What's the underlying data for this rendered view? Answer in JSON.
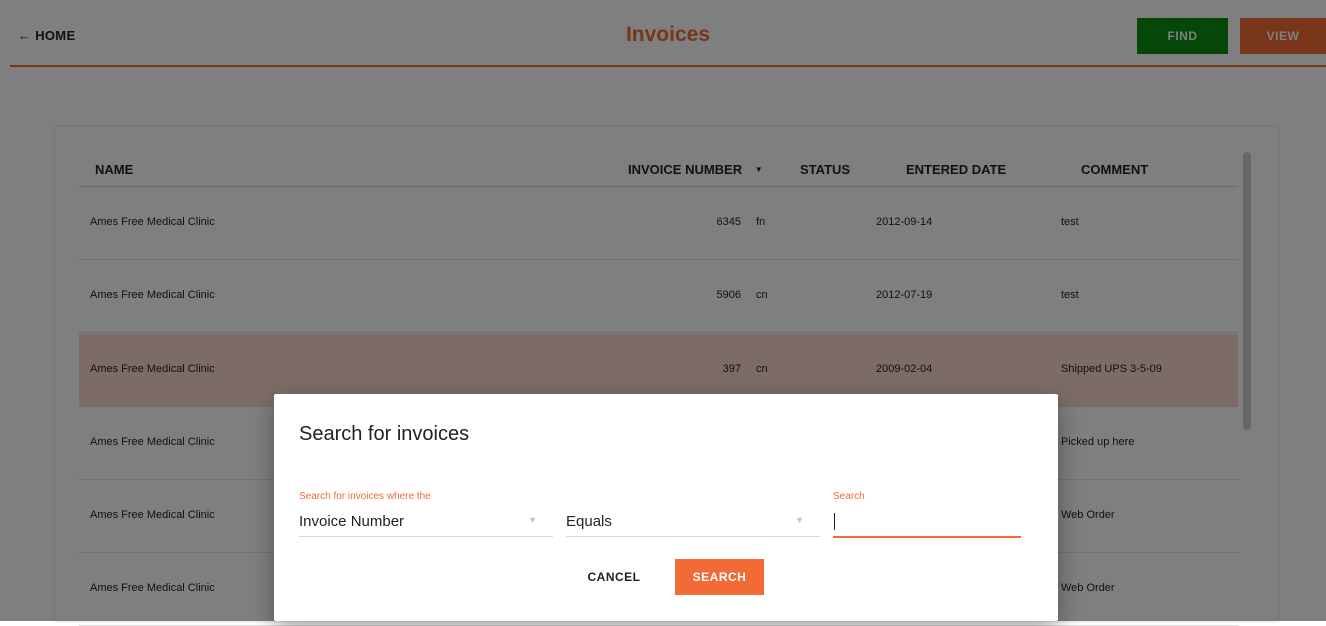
{
  "header": {
    "home_label": "← HOME",
    "title": "Invoices",
    "find_label": "FIND",
    "view_label": "VIEW"
  },
  "table": {
    "columns": [
      "NAME",
      "INVOICE NUMBER",
      "STATUS",
      "ENTERED DATE",
      "COMMENT"
    ],
    "sort_indicator": "▼",
    "rows": [
      {
        "name": "Ames Free Medical Clinic",
        "invoice_number": "6345",
        "status": "fn",
        "entered_date": "2012-09-14",
        "comment": "test"
      },
      {
        "name": "Ames Free Medical Clinic",
        "invoice_number": "5906",
        "status": "cn",
        "entered_date": "2012-07-19",
        "comment": "test"
      },
      {
        "name": "Ames Free Medical Clinic",
        "invoice_number": "397",
        "status": "cn",
        "entered_date": "2009-02-04",
        "comment": "Shipped UPS 3-5-09"
      },
      {
        "name": "Ames Free Medical Clinic",
        "invoice_number": "",
        "status": "",
        "entered_date": "",
        "comment": "Picked up here"
      },
      {
        "name": "Ames Free Medical Clinic",
        "invoice_number": "",
        "status": "",
        "entered_date": "",
        "comment": "Web Order"
      },
      {
        "name": "Ames Free Medical Clinic",
        "invoice_number": "",
        "status": "",
        "entered_date": "",
        "comment": "Web Order"
      }
    ]
  },
  "dialog": {
    "title": "Search for invoices",
    "field_label": "Search for invoices where the",
    "field_value": "Invoice Number",
    "operator_value": "Equals",
    "search_label": "Search",
    "search_value": "",
    "cancel_label": "CANCEL",
    "submit_label": "SEARCH"
  },
  "colors": {
    "accent": "#f26a35",
    "find_button": "#0b8e0f",
    "selected_row": "#fbd9cd"
  }
}
